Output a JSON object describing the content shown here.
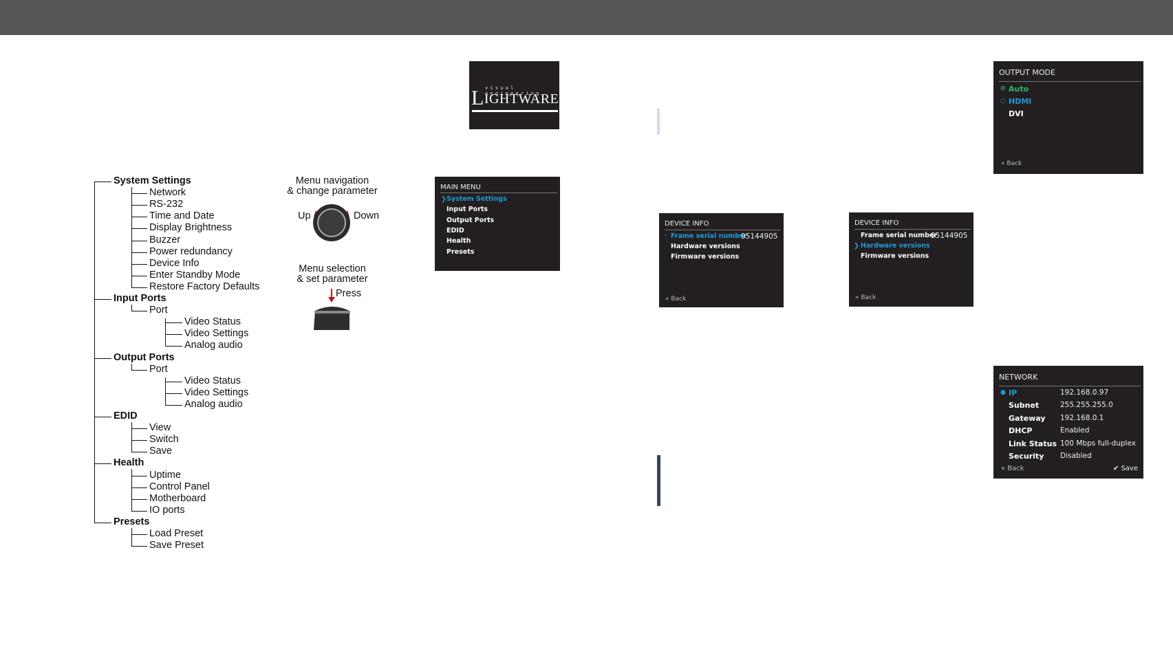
{
  "logo": {
    "tagline": "visual engineering",
    "wordmark_first": "L",
    "wordmark_rest": "IGHTWARE"
  },
  "tree": [
    {
      "label": "System Settings",
      "level": 1
    },
    {
      "label": "Network",
      "level": 2
    },
    {
      "label": "RS-232",
      "level": 2
    },
    {
      "label": "Time and Date",
      "level": 2
    },
    {
      "label": "Display Brightness",
      "level": 2
    },
    {
      "label": "Buzzer",
      "level": 2
    },
    {
      "label": "Power redundancy",
      "level": 2
    },
    {
      "label": "Device Info",
      "level": 2
    },
    {
      "label": "Enter Standby Mode",
      "level": 2
    },
    {
      "label": "Restore Factory Defaults",
      "level": 2
    },
    {
      "label": "Input Ports",
      "level": 1
    },
    {
      "label": "Port",
      "level": 2
    },
    {
      "label": "Video Status",
      "level": 3
    },
    {
      "label": "Video Settings",
      "level": 3
    },
    {
      "label": "Analog audio",
      "level": 3
    },
    {
      "label": "Output Ports",
      "level": 1
    },
    {
      "label": "Port",
      "level": 2
    },
    {
      "label": "Video Status",
      "level": 3
    },
    {
      "label": "Video Settings",
      "level": 3
    },
    {
      "label": "Analog audio",
      "level": 3
    },
    {
      "label": "EDID",
      "level": 1
    },
    {
      "label": "View",
      "level": 2
    },
    {
      "label": "Switch",
      "level": 2
    },
    {
      "label": "Save",
      "level": 2
    },
    {
      "label": "Health",
      "level": 1
    },
    {
      "label": "Uptime",
      "level": 2
    },
    {
      "label": "Control Panel",
      "level": 2
    },
    {
      "label": "Motherboard",
      "level": 2
    },
    {
      "label": "IO ports",
      "level": 2
    },
    {
      "label": "Presets",
      "level": 1
    },
    {
      "label": "Load Preset",
      "level": 2
    },
    {
      "label": "Save Preset",
      "level": 2
    }
  ],
  "knob": {
    "nav_line1": "Menu navigation",
    "nav_line2": "& change parameter",
    "up": "Up",
    "down": "Down",
    "sel_line1": "Menu selection",
    "sel_line2": "& set parameter",
    "press": "Press"
  },
  "main_menu": {
    "title": "MAIN MENU",
    "items": [
      "System Settings",
      "Input Ports",
      "Output Ports",
      "EDID",
      "Health",
      "Presets"
    ],
    "selected": "System Settings"
  },
  "device_info_1": {
    "title": "DEVICE INFO",
    "items": [
      "Frame serial number",
      "Hardware versions",
      "Firmware versions"
    ],
    "serial": "95144905",
    "back": "« Back"
  },
  "device_info_2": {
    "title": "DEVICE INFO",
    "items": [
      "Frame serial number",
      "Hardware versions",
      "Firmware versions"
    ],
    "serial": "95144905",
    "back": "« Back"
  },
  "output_mode": {
    "title": "OUTPUT MODE",
    "items": [
      "Auto",
      "HDMI",
      "DVI"
    ],
    "back": "« Back"
  },
  "network": {
    "title": "NETWORK",
    "rows": [
      {
        "label": "IP",
        "value": "192.168.0.97"
      },
      {
        "label": "Subnet",
        "value": "255.255.255.0"
      },
      {
        "label": "Gateway",
        "value": "192.168.0.1"
      },
      {
        "label": "DHCP",
        "value": "Enabled"
      },
      {
        "label": "Link Status",
        "value": "100 Mbps full-duplex"
      },
      {
        "label": "Security",
        "value": "Disabled"
      }
    ],
    "back": "« Back",
    "save": "✔ Save"
  },
  "colors": {
    "header": "#555555",
    "lcd_bg": "#231f20",
    "selected": "#1e9ad6",
    "active": "#2dbb6b",
    "arrow": "#c0161c"
  }
}
